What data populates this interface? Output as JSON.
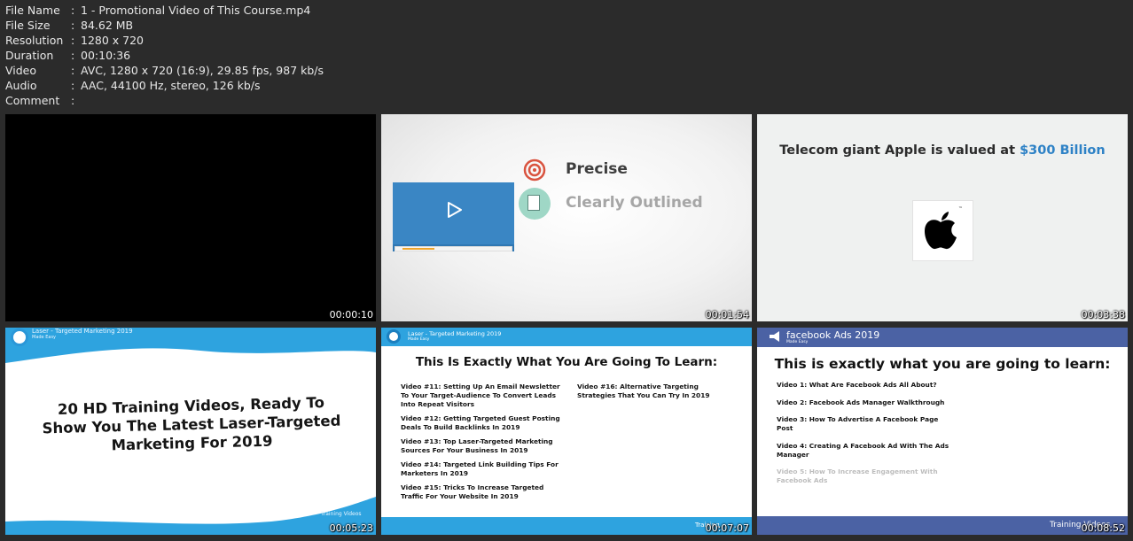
{
  "info": [
    {
      "key": "File Name",
      "sep": ":",
      "value": "1 - Promotional Video of This Course.mp4"
    },
    {
      "key": "File Size",
      "sep": ":",
      "value": "84.62 MB"
    },
    {
      "key": "Resolution",
      "sep": ":",
      "value": "1280 x 720"
    },
    {
      "key": "Duration",
      "sep": ":",
      "value": "00:10:36"
    },
    {
      "key": "Video",
      "sep": ":",
      "value": "AVC, 1280 x 720 (16:9), 29.85 fps, 987 kb/s"
    },
    {
      "key": "Audio",
      "sep": ":",
      "value": "AAC, 44100 Hz, stereo, 126 kb/s"
    },
    {
      "key": "Comment",
      "sep": ":",
      "value": ""
    }
  ],
  "thumbs": [
    {
      "timestamp": "00:00:10"
    },
    {
      "timestamp": "00:01:54",
      "feature_1": "Precise",
      "feature_2": "Clearly Outlined"
    },
    {
      "timestamp": "00:03:38",
      "headline": "Telecom giant Apple is valued at ",
      "headline_accent": "$300 Billion",
      "tm": "™"
    },
    {
      "timestamp": "00:05:23",
      "header_1": "Laser - Targeted Marketing 2019",
      "header_2": "Made Easy",
      "text": "20 HD Training Videos, Ready To Show You The Latest Laser-Targeted Marketing For 2019",
      "footer": "Training Videos"
    },
    {
      "timestamp": "00:07:07",
      "header_1": "Laser - Targeted Marketing 2019",
      "header_2": "Made Easy",
      "title": "This Is Exactly What You Are Going To Learn:",
      "col_1": [
        "Video #11: Setting Up An Email Newsletter To Your Target-Audience To Convert Leads Into Repeat Visitors",
        "Video #12: Getting Targeted Guest Posting Deals To Build Backlinks In 2019",
        "Video #13: Top Laser-Targeted Marketing Sources For Your Business In 2019",
        "Video #14: Targeted Link Building Tips For Marketers In 2019",
        "Video #15: Tricks To Increase Targeted Traffic For Your Website In 2019"
      ],
      "col_2": [
        "Video #16: Alternative Targeting Strategies That You Can Try In 2019"
      ],
      "footer": "Training"
    },
    {
      "timestamp": "00:08:52",
      "brand": "facebook Ads 2019",
      "sub": "Made Easy",
      "title": "This is exactly what you are going to learn:",
      "items": [
        "Video 1: What Are Facebook Ads All About?",
        "Video 2: Facebook Ads Manager Walkthrough",
        "Video 3: How To Advertise A Facebook Page Post",
        "Video 4: Creating A Facebook Ad With The Ads Manager",
        "Video 5: How To Increase Engagement With Facebook Ads"
      ],
      "footer": "Training Videos"
    }
  ],
  "colors": {
    "background": "#2b2b2b",
    "laser_blue": "#2ea3df",
    "facebook_blue": "#4b62a4",
    "accent_blue": "#2e82c6"
  }
}
